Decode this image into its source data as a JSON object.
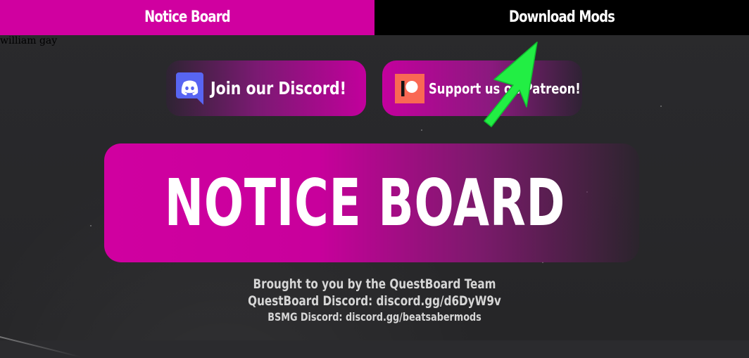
{
  "nav": {
    "tabs": [
      {
        "label": "Notice Board",
        "active": true
      },
      {
        "label": "Download Mods",
        "active": false
      }
    ]
  },
  "caption": "william gay",
  "buttons": {
    "discord": {
      "label": "Join our Discord!",
      "icon": "discord-icon"
    },
    "patreon": {
      "label": "Support us on Patreon!",
      "icon": "patreon-icon"
    }
  },
  "hero": {
    "title": "NOTICE BOARD"
  },
  "credits": {
    "line1": "Brought to you by the QuestBoard Team",
    "line2": "QuestBoard Discord: discord.gg/d6DyW9v",
    "line3": "BSMG Discord: discord.gg/beatsabermods"
  },
  "annotation": {
    "icon": "green-arrow-icon",
    "color": "#22ee44"
  },
  "colors": {
    "accent": "#d000a0",
    "nav_inactive": "#000000",
    "background": "#2b2b2e",
    "discord_blurple": "#5865f2",
    "patreon_coral": "#f96854"
  }
}
